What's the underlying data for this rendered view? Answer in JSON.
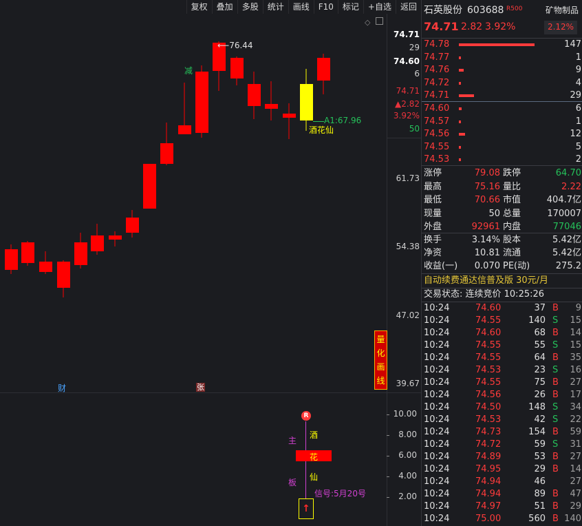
{
  "toolbar": [
    "复权",
    "叠加",
    "多股",
    "统计",
    "画线",
    "F10",
    "标记",
    "+自选",
    "返回"
  ],
  "chart": {
    "price_axis": [
      "74.71",
      "29",
      "74.60",
      "6",
      "74.71",
      "▲2.82",
      "3.92%",
      "50",
      "61.73",
      "54.38",
      "47.02",
      "39.67"
    ],
    "indicator_axis": [
      "10.00",
      "8.00",
      "6.00",
      "4.00",
      "2.00"
    ],
    "high_label": "76.44",
    "a1_label": "A1:67.96",
    "stock_label": "酒花仙",
    "jian_label": "减",
    "cai_label": "财",
    "zhang_label": "张",
    "quant_label": [
      "量",
      "化",
      "画",
      "线"
    ],
    "signal_chars": [
      "酒",
      "花",
      "仙"
    ],
    "main_chars": [
      "主",
      "板"
    ],
    "signal_text": "信号:5月20号",
    "r_badge": "R",
    "arrow": "↑",
    "colors": {
      "up": "#ff0000",
      "highlight": "#ffff00",
      "bg": "#1b1c20"
    }
  },
  "quote": {
    "name": "石英股份",
    "code": "603688",
    "tag": "R500",
    "sector": "矿物制品",
    "sector_pct": "2.12%",
    "price": "74.71",
    "change": "2.82",
    "change_pct": "3.92%",
    "asks": [
      {
        "price": "74.78",
        "vol": "147",
        "bar": 1.0
      },
      {
        "price": "74.77",
        "vol": "1",
        "bar": 0.02
      },
      {
        "price": "74.76",
        "vol": "9",
        "bar": 0.06
      },
      {
        "price": "74.72",
        "vol": "4",
        "bar": 0.03
      },
      {
        "price": "74.71",
        "vol": "29",
        "bar": 0.2
      }
    ],
    "bids": [
      {
        "price": "74.60",
        "vol": "6",
        "bar": 0.04
      },
      {
        "price": "74.57",
        "vol": "1",
        "bar": 0.02
      },
      {
        "price": "74.56",
        "vol": "12",
        "bar": 0.08
      },
      {
        "price": "74.55",
        "vol": "5",
        "bar": 0.03
      },
      {
        "price": "74.53",
        "vol": "2",
        "bar": 0.02
      }
    ],
    "stats": [
      {
        "l1": "涨停",
        "v1": "79.08",
        "c1": "red",
        "l2": "跌停",
        "v2": "64.70",
        "c2": "grn"
      },
      {
        "l1": "最高",
        "v1": "75.16",
        "c1": "red",
        "l2": "量比",
        "v2": "2.22",
        "c2": "red"
      },
      {
        "l1": "最低",
        "v1": "70.66",
        "c1": "red",
        "l2": "市值",
        "v2": "404.7亿",
        "c2": "wht"
      },
      {
        "l1": "现量",
        "v1": "50",
        "c1": "wht",
        "l2": "总量",
        "v2": "170007",
        "c2": "wht"
      },
      {
        "l1": "外盘",
        "v1": "92961",
        "c1": "red",
        "l2": "内盘",
        "v2": "77046",
        "c2": "grn"
      }
    ],
    "stats2": [
      {
        "l1": "换手",
        "v1": "3.14%",
        "l2": "股本",
        "v2": "5.42亿"
      },
      {
        "l1": "净资",
        "v1": "10.81",
        "l2": "流通",
        "v2": "5.42亿"
      },
      {
        "l1": "收益(一)",
        "v1": "0.070",
        "l2": "PE(动)",
        "v2": "275.2"
      }
    ],
    "promo": "自动续费通达信普及版  30元/月",
    "status": "交易状态: 连续竞价 10:25:26",
    "ticks": [
      {
        "t": "10:24",
        "p": "74.60",
        "v": "37",
        "d": "B",
        "n": "9"
      },
      {
        "t": "10:24",
        "p": "74.55",
        "v": "140",
        "d": "S",
        "n": "15"
      },
      {
        "t": "10:24",
        "p": "74.60",
        "v": "68",
        "d": "B",
        "n": "14"
      },
      {
        "t": "10:24",
        "p": "74.55",
        "v": "55",
        "d": "S",
        "n": "15"
      },
      {
        "t": "10:24",
        "p": "74.55",
        "v": "64",
        "d": "B",
        "n": "35"
      },
      {
        "t": "10:24",
        "p": "74.53",
        "v": "23",
        "d": "S",
        "n": "16"
      },
      {
        "t": "10:24",
        "p": "74.55",
        "v": "75",
        "d": "B",
        "n": "27"
      },
      {
        "t": "10:24",
        "p": "74.56",
        "v": "26",
        "d": "B",
        "n": "17"
      },
      {
        "t": "10:24",
        "p": "74.50",
        "v": "148",
        "d": "S",
        "n": "34"
      },
      {
        "t": "10:24",
        "p": "74.53",
        "v": "42",
        "d": "S",
        "n": "22"
      },
      {
        "t": "10:24",
        "p": "74.73",
        "v": "154",
        "d": "B",
        "n": "59"
      },
      {
        "t": "10:24",
        "p": "74.72",
        "v": "59",
        "d": "S",
        "n": "31"
      },
      {
        "t": "10:24",
        "p": "74.89",
        "v": "53",
        "d": "B",
        "n": "27"
      },
      {
        "t": "10:24",
        "p": "74.95",
        "v": "29",
        "d": "B",
        "n": "14"
      },
      {
        "t": "10:24",
        "p": "74.94",
        "v": "46",
        "d": "",
        "n": "27"
      },
      {
        "t": "10:24",
        "p": "74.94",
        "v": "89",
        "d": "B",
        "n": "47"
      },
      {
        "t": "10:24",
        "p": "74.97",
        "v": "51",
        "d": "B",
        "n": "29"
      },
      {
        "t": "10:24",
        "p": "75.00",
        "v": "560",
        "d": "B",
        "n": "140"
      }
    ]
  }
}
